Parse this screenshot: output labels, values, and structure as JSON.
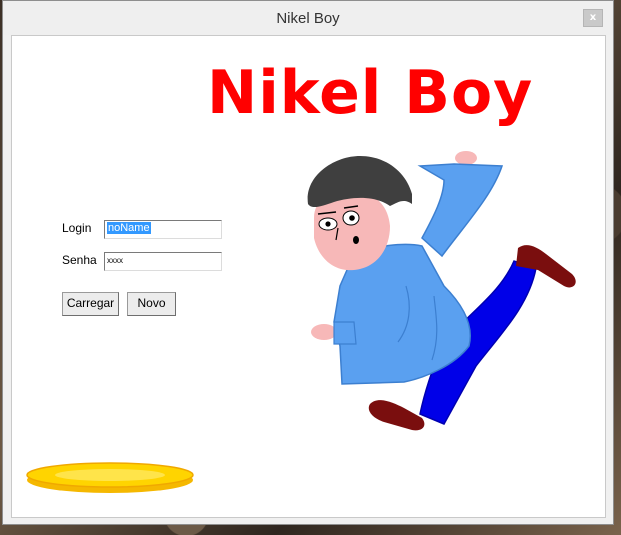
{
  "window": {
    "title": "Nikel Boy",
    "close_label": "x"
  },
  "heading": "Nikel Boy",
  "form": {
    "login_label": "Login",
    "login_value": "noName",
    "password_label": "Senha",
    "password_value": "xxxx",
    "load_button": "Carregar",
    "new_button": "Novo"
  },
  "images": {
    "character": "nikel-boy-running-illustration",
    "coin": "gold-nickel-coin"
  }
}
